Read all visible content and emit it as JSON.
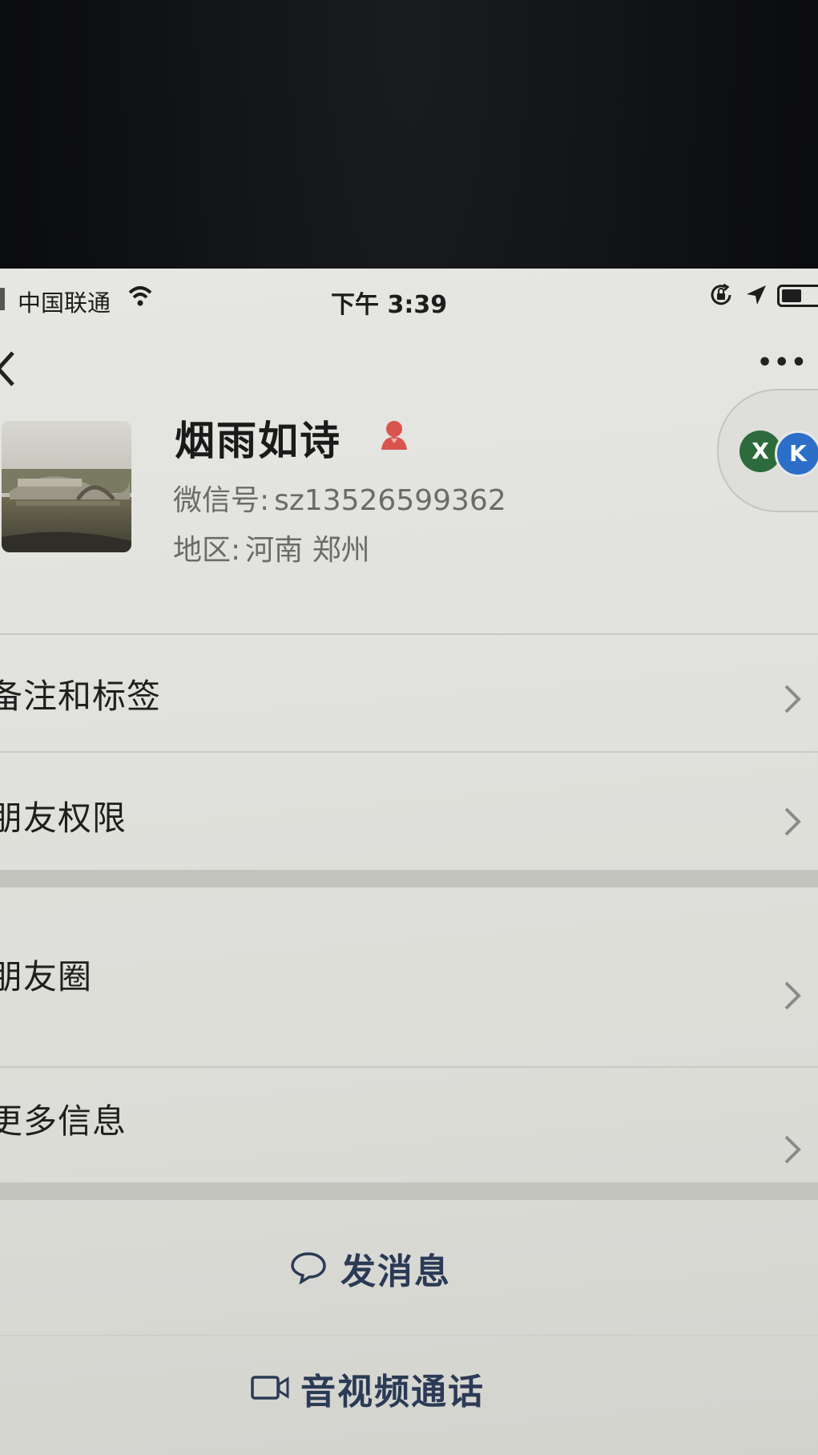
{
  "status_bar": {
    "carrier": "中国联通",
    "time": "下午 3:39"
  },
  "nav": {
    "more_label": "•••"
  },
  "profile": {
    "name": "烟雨如诗",
    "wechat_id_label": "微信号:",
    "wechat_id": "sz13526599362",
    "region_label": "地区:",
    "region": "河南 郑州",
    "gender_icon": "female-user-icon"
  },
  "chip": {
    "left_letter": "X",
    "right_letter": "K"
  },
  "menu": {
    "items": [
      {
        "label": "备注和标签"
      },
      {
        "label": "朋友权限"
      },
      {
        "label": "朋友圈"
      },
      {
        "label": "更多信息"
      }
    ]
  },
  "actions": {
    "send_message": "发消息",
    "av_call": "音视频通话"
  },
  "colors": {
    "gender_icon": "#d9534f",
    "action_text": "#2b3a55"
  }
}
